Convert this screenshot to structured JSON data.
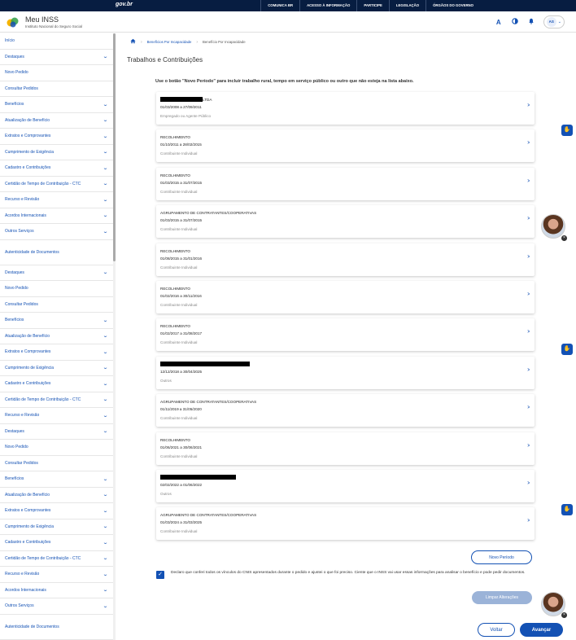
{
  "govbar": {
    "logo": "gov.br",
    "links": [
      "COMUNICA BR",
      "ACESSO À INFORMAÇÃO",
      "PARTICIPE",
      "LEGISLAÇÃO",
      "ÓRGÃOS DO GOVERNO"
    ]
  },
  "header": {
    "title": "Meu INSS",
    "subtitle": "Instituto Nacional do Seguro Social",
    "font_icon": "A",
    "contrast_icon": "contrast-icon",
    "bell_icon": "bell-icon",
    "avatar_initials": "AS"
  },
  "sidebar": {
    "items": [
      {
        "label": "Início",
        "chevron": false
      },
      {
        "label": "Destaques",
        "chevron": true
      },
      {
        "label": "Novo Pedido",
        "chevron": false
      },
      {
        "label": "Consultar Pedidos",
        "chevron": false
      },
      {
        "label": "Benefícios",
        "chevron": true
      },
      {
        "label": "Atualização de Benefício",
        "chevron": true
      },
      {
        "label": "Extratos e Comprovantes",
        "chevron": true
      },
      {
        "label": "Cumprimento de Exigência",
        "chevron": true
      },
      {
        "label": "Cadastro e Contribuições",
        "chevron": true
      },
      {
        "label": "Certidão de Tempo de Contribuição - CTC",
        "chevron": true
      },
      {
        "label": "Recurso e Revisão",
        "chevron": true
      },
      {
        "label": "Acordos Internacionais",
        "chevron": true
      },
      {
        "label": "Outros Serviços",
        "chevron": true
      },
      {
        "label": "Autenticidade de Documentos",
        "chevron": false,
        "tall": true
      },
      {
        "label": "Destaques",
        "chevron": true
      },
      {
        "label": "Novo Pedido",
        "chevron": false
      },
      {
        "label": "Consultar Pedidos",
        "chevron": false
      },
      {
        "label": "Benefícios",
        "chevron": true
      },
      {
        "label": "Atualização de Benefício",
        "chevron": true
      },
      {
        "label": "Extratos e Comprovantes",
        "chevron": true
      },
      {
        "label": "Cumprimento de Exigência",
        "chevron": true
      },
      {
        "label": "Cadastro e Contribuições",
        "chevron": true
      },
      {
        "label": "Certidão de Tempo de Contribuição - CTC",
        "chevron": true
      },
      {
        "label": "Recurso e Revisão",
        "chevron": true
      },
      {
        "label": "Destaques",
        "chevron": true
      },
      {
        "label": "Novo Pedido",
        "chevron": false
      },
      {
        "label": "Consultar Pedidos",
        "chevron": false
      },
      {
        "label": "Benefícios",
        "chevron": true
      },
      {
        "label": "Atualização de Benefício",
        "chevron": true
      },
      {
        "label": "Extratos e Comprovantes",
        "chevron": true
      },
      {
        "label": "Cumprimento de Exigência",
        "chevron": true
      },
      {
        "label": "Cadastro e Contribuições",
        "chevron": true
      },
      {
        "label": "Certidão de Tempo de Contribuição - CTC",
        "chevron": true
      },
      {
        "label": "Recurso e Revisão",
        "chevron": true
      },
      {
        "label": "Acordos Internacionais",
        "chevron": true
      },
      {
        "label": "Outros Serviços",
        "chevron": true
      },
      {
        "label": "Autenticidade de Documentos",
        "chevron": false,
        "tall": true
      }
    ]
  },
  "breadcrumb": {
    "items": [
      "Benefícios Por Incapacidade",
      "Benefício Por Incapacidade"
    ]
  },
  "main": {
    "title": "Trabalhos e Contribuições",
    "intro": "Use o botão \"Novo Período\" para incluir trabalho rural, tempo em serviço público ou outro que não esteja na lista abaixo.",
    "cards": [
      {
        "line1": "LTDA",
        "redact_w": 52,
        "line2": "01/03/2008 a 27/09/2011",
        "line3": "Empregado ou Agente Público"
      },
      {
        "line1": "RECOLHIMENTO",
        "line2": "01/10/2011 a 28/02/2015",
        "line3": "Contribuinte Individual"
      },
      {
        "line1": "RECOLHIMENTO",
        "line2": "01/03/2015 a 31/07/2015",
        "line3": "Contribuinte Individual"
      },
      {
        "line1": "AGRUPAMENTO DE CONTRATANTES/COOPERATIVAS",
        "line2": "01/03/2015 a 31/07/2015",
        "line3": "Contribuinte Individual"
      },
      {
        "line1": "RECOLHIMENTO",
        "line2": "01/08/2015 a 31/01/2016",
        "line3": "Contribuinte Individual"
      },
      {
        "line1": "RECOLHIMENTO",
        "line2": "01/02/2016 a 30/11/2016",
        "line3": "Contribuinte Individual"
      },
      {
        "line1": "RECOLHIMENTO",
        "line2": "01/02/2017 a 31/08/2017",
        "line3": "Contribuinte Individual"
      },
      {
        "line1": "",
        "redact_w": 110,
        "line2": "12/12/2018 a 30/04/2025",
        "line3": "Outros"
      },
      {
        "line1": "AGRUPAMENTO DE CONTRATANTES/COOPERATIVAS",
        "line2": "01/11/2019 a 31/05/2020",
        "line3": "Contribuinte Individual"
      },
      {
        "line1": "RECOLHIMENTO",
        "line2": "01/06/2021 a 30/06/2021",
        "line3": "Contribuinte Individual"
      },
      {
        "line1": "",
        "redact_w": 93,
        "line2": "02/02/2022 a 01/06/2022",
        "line3": "Outros"
      },
      {
        "line1": "AGRUPAMENTO DE CONTRATANTES/COOPERATIVAS",
        "line2": "01/03/2024 a 31/03/2025",
        "line3": "Contribuinte Individual"
      }
    ],
    "new_period_label": "Novo Período",
    "declaration": "Declaro que conferi todos os vínculos do CNIS apresentados durante o pedido e ajustei o que foi preciso. Ciente que o INSS vai usar essas informações para analisar o benefício e pode pedir documentos.",
    "declaration_checked": true,
    "clear_label": "Limpar Alterações",
    "back_label": "Voltar",
    "next_label": "Avançar"
  },
  "colors": {
    "primary": "#1351b4",
    "govbar": "#071d41",
    "disabled": "#9bb3d8"
  }
}
